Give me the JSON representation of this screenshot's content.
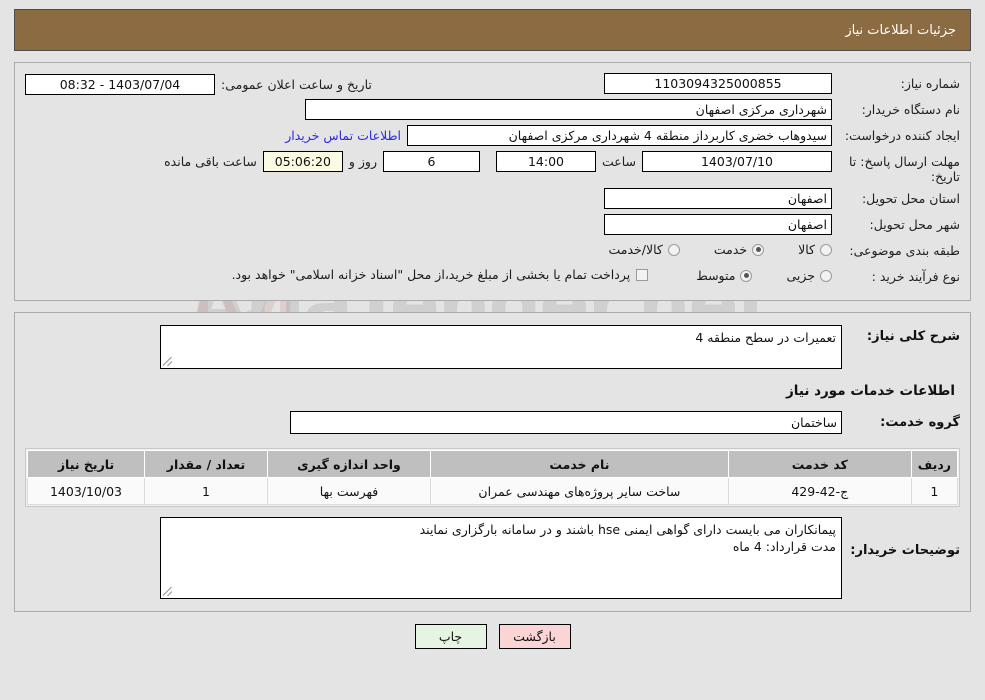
{
  "header": {
    "title": "جزئیات اطلاعات نیاز"
  },
  "watermark": {
    "text": "AriaTender.net",
    "shield_color": "#d9a8a8"
  },
  "form": {
    "labels": {
      "need_number": "شماره نیاز:",
      "buyer_org": "نام دستگاه خریدار:",
      "requester": "ایجاد کننده درخواست:",
      "deadline": "مهلت ارسال پاسخ: تا تاریخ:",
      "province": "استان محل تحویل:",
      "city": "شهر محل تحویل:",
      "category": "طبقه بندی موضوعی:",
      "purchase_type": "نوع فرآیند خرید :",
      "publish_datetime": "تاریخ و ساعت اعلان عمومی:"
    },
    "values": {
      "need_number": "1103094325000855",
      "buyer_org": "شهرداری مرکزی اصفهان",
      "requester": "سیدوهاب خضری کاربرداز منطقه 4 شهرداری مرکزی اصفهان",
      "deadline_date": "1403/07/10",
      "deadline_time": "14:00",
      "remaining_days": "6",
      "remaining_clock": "05:06:20",
      "province": "اصفهان",
      "city": "اصفهان",
      "publish_datetime": "1403/07/04 - 08:32"
    },
    "inline": {
      "hour_word": "ساعت",
      "days_and": "روز و",
      "hours_remaining": "ساعت باقی مانده",
      "buyer_contact_link": "اطلاعات تماس خریدار"
    },
    "category_options": [
      {
        "label": "کالا",
        "selected": false
      },
      {
        "label": "خدمت",
        "selected": true
      },
      {
        "label": "کالا/خدمت",
        "selected": false
      }
    ],
    "purchase_options": [
      {
        "label": "جزیی",
        "selected": false
      },
      {
        "label": "متوسط",
        "selected": true
      }
    ],
    "treasury_checkbox": {
      "checked": false,
      "label": "پرداخت تمام یا بخشی از مبلغ خرید،از محل \"اسناد خزانه اسلامی\" خواهد بود."
    }
  },
  "details": {
    "need_description_label": "شرح کلی نیاز:",
    "need_description_value": "تعمیرات در سطح منطقه 4",
    "services_section_title": "اطلاعات خدمات مورد نیاز",
    "service_group_label": "گروه خدمت:",
    "service_group_value": "ساختمان",
    "buyer_notes_label": "توضیحات خریدار:",
    "buyer_notes_value": "پیمانکاران می بایست دارای گواهی ایمنی hse باشند و در سامانه بارگزاری نمایند\nمدت قرارداد: 4 ماه"
  },
  "table": {
    "headers": {
      "row": "ردیف",
      "code": "کد خدمت",
      "name": "نام خدمت",
      "unit": "واحد اندازه گیری",
      "qty": "تعداد / مقدار",
      "date": "تاریخ نیاز"
    },
    "rows": [
      {
        "row": "1",
        "code": "ج-42-429",
        "name": "ساخت سایر پروژه‌های مهندسی عمران",
        "unit": "فهرست بها",
        "qty": "1",
        "date": "1403/10/03"
      }
    ]
  },
  "footer": {
    "back_label": "بازگشت",
    "print_label": "چاپ"
  }
}
